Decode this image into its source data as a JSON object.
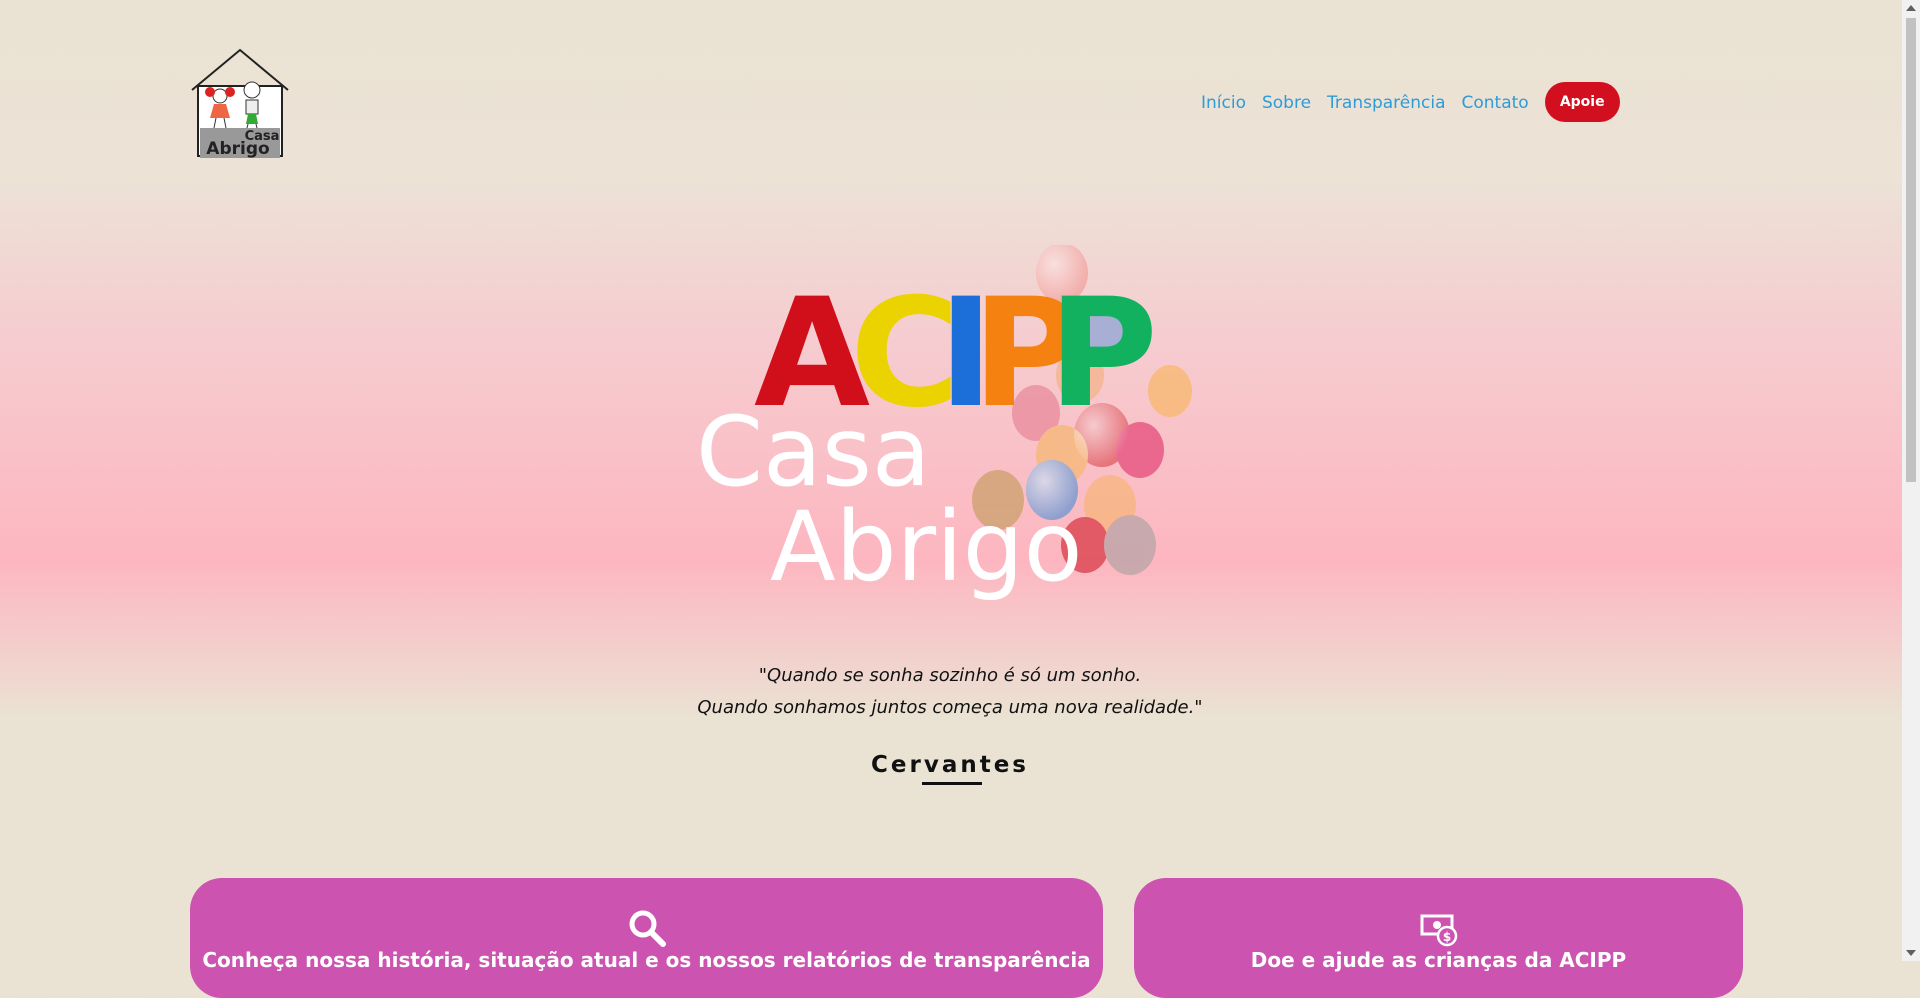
{
  "logo": {
    "line1": "Casa",
    "line2": "Abrigo"
  },
  "nav": {
    "items": [
      "Início",
      "Sobre",
      "Transparência",
      "Contato"
    ],
    "cta": "Apoie",
    "link_color": "#2e9bd8",
    "cta_color": "#d20f1e"
  },
  "hero": {
    "letters": [
      "A",
      "C",
      "I",
      "P",
      "P"
    ],
    "letter_colors": [
      "#d10f1b",
      "#ead300",
      "#1c6ed8",
      "#f58110",
      "#12b15f"
    ],
    "line1": "Casa",
    "line2": "Abrigo"
  },
  "quote": {
    "line1": "\"Quando se sonha sozinho é só um sonho.",
    "line2": "Quando sonhamos juntos começa uma nova realidade.\"",
    "author": "Cervantes"
  },
  "cards": [
    {
      "icon": "search-icon",
      "text": "Conheça nossa história, situação atual e os nossos relatórios de transparência"
    },
    {
      "icon": "money-icon",
      "text": "Doe e ajude as crianças da ACIPP"
    }
  ],
  "colors": {
    "card": "#cc54b0",
    "background": "#eae3d3"
  }
}
